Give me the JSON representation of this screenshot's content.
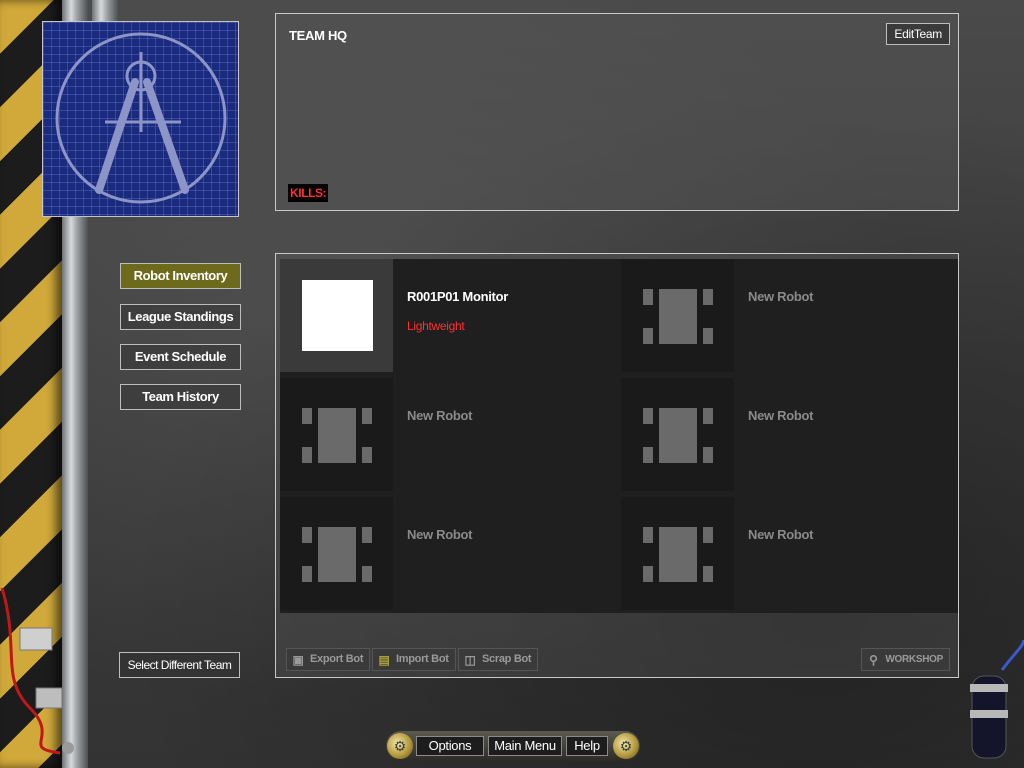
{
  "hq": {
    "title": "TEAM HQ",
    "edit_label": "EditTeam",
    "kills_label": "KILLS:"
  },
  "nav": {
    "items": [
      {
        "label": "Robot Inventory",
        "active": true
      },
      {
        "label": "League Standings",
        "active": false
      },
      {
        "label": "Event Schedule",
        "active": false
      },
      {
        "label": "Team History",
        "active": false
      }
    ],
    "select_team_label": "Select Different Team"
  },
  "inventory": {
    "slots": [
      {
        "name": "R001P01 Monitor",
        "class": "Lightweight",
        "filled": true
      },
      {
        "name": "New Robot",
        "filled": false
      },
      {
        "name": "New Robot",
        "filled": false
      },
      {
        "name": "New Robot",
        "filled": false
      },
      {
        "name": "New Robot",
        "filled": false
      },
      {
        "name": "New Robot",
        "filled": false
      }
    ],
    "toolbar": {
      "export_label": "Export Bot",
      "import_label": "Import Bot",
      "scrap_label": "Scrap Bot",
      "workshop_label": "WORKSHOP"
    }
  },
  "bottom_menu": {
    "options_label": "Options",
    "main_menu_label": "Main Menu",
    "help_label": "Help"
  },
  "colors": {
    "active_nav": "#6d6a1c",
    "weight_class": "#ff3030",
    "logo_bg": "#1a2a7c"
  }
}
